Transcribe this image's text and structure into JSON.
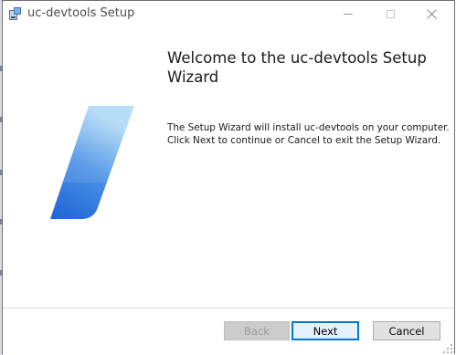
{
  "window": {
    "title": "uc-devtools Setup"
  },
  "icons": {
    "app": "installer-icon",
    "minimize": "minimize-icon",
    "maximize": "maximize-icon",
    "close": "close-icon",
    "logo": "uc-devtools-logo"
  },
  "content": {
    "heading": "Welcome to the uc-devtools Setup Wizard",
    "body_line1": "The Setup Wizard will install uc-devtools on your computer.",
    "body_line2": "Click Next to continue or Cancel to exit the Setup Wizard."
  },
  "buttons": {
    "back": "Back",
    "next": "Next",
    "cancel": "Cancel"
  },
  "colors": {
    "accent": "#0078d7",
    "logo_light": "#a8d6f5",
    "logo_dark": "#1d63d6"
  }
}
